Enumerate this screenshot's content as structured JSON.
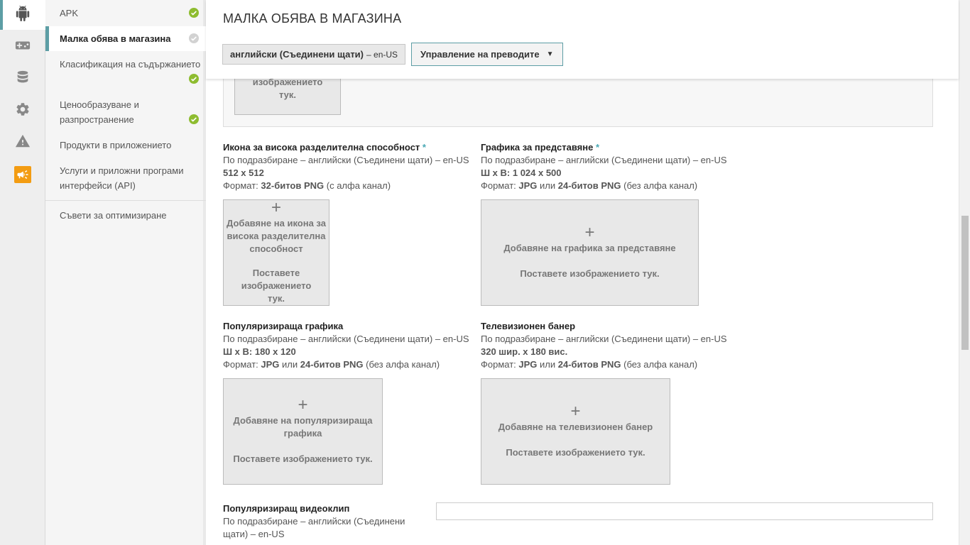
{
  "rail": {
    "items": [
      {
        "icon": "android-icon"
      },
      {
        "icon": "gamepad-icon"
      },
      {
        "icon": "database-icon"
      },
      {
        "icon": "gear-icon"
      },
      {
        "icon": "alert-icon"
      },
      {
        "icon": "megaphone-icon"
      }
    ],
    "accent": "#5d9ea5",
    "orange": "#f39c12"
  },
  "nav": {
    "items": [
      {
        "label": "APK",
        "status": "complete"
      },
      {
        "label": "Малка обява в магазина",
        "status": "incomplete"
      },
      {
        "label": "Класификация на съдържанието",
        "status": "complete"
      },
      {
        "label": "Ценообразуване и разпространение",
        "status": "complete"
      },
      {
        "label": "Продукти в приложението"
      },
      {
        "label": "Услуги и приложни програми интерфейси (API)"
      },
      {
        "label": "Съвети за оптимизиране"
      }
    ],
    "check_color": "#8ebc30"
  },
  "header": {
    "title": "МАЛКА ОБЯВА В МАГАЗИНА",
    "language": "английски (Съединени щати)",
    "language_code": "– en-US",
    "translations_button": "Управление на преводите"
  },
  "prev_drop": {
    "text": "Поставете изображението тук."
  },
  "fields": {
    "hi_res_icon": {
      "label": "Икона за висока разделителна способност",
      "required": "*",
      "default": "По подразбиране – английски (Съединени щати) – en-US",
      "size": "512 x 512",
      "format_prefix": "Формат: ",
      "format_bold": "32-битов PNG",
      "format_suffix": " (с алфа канал)",
      "drop_plus": "+",
      "drop_add": "Добавяне на икона за висока разделителна способност",
      "drop_paste": "Поставете изображението тук."
    },
    "feature_graphic": {
      "label": "Графика за представяне",
      "required": "*",
      "default": "По подразбиране – английски (Съединени щати) – en-US",
      "size": "Ш x В: 1 024 x 500",
      "format_prefix": "Формат: ",
      "format_a": "JPG",
      "format_or": " или ",
      "format_b": "24-битов PNG",
      "format_suffix": " (без алфа канал)",
      "drop_plus": "+",
      "drop_add": "Добавяне на графика за представяне",
      "drop_paste": "Поставете изображението тук."
    },
    "promo_graphic": {
      "label": "Популяризираща графика",
      "default": "По подразбиране – английски (Съединени щати) – en-US",
      "size": "Ш x В: 180 x 120",
      "format_prefix": "Формат: ",
      "format_a": "JPG",
      "format_or": " или ",
      "format_b": "24-битов PNG",
      "format_suffix": " (без алфа канал)",
      "drop_plus": "+",
      "drop_add": "Добавяне на популяризираща графика",
      "drop_paste": "Поставете изображението тук."
    },
    "tv_banner": {
      "label": "Телевизионен банер",
      "default": "По подразбиране – английски (Съединени щати) – en-US",
      "size": "320 шир. x 180 вис.",
      "format_prefix": "Формат: ",
      "format_a": "JPG",
      "format_or": " или ",
      "format_b": "24-битов PNG",
      "format_suffix": " (без алфа канал)",
      "drop_plus": "+",
      "drop_add": "Добавяне на телевизионен банер",
      "drop_paste": "Поставете изображението тук."
    },
    "promo_video": {
      "label": "Популяризиращ видеоклип",
      "default": "По подразбиране – английски (Съединени щати) – en-US",
      "value": ""
    }
  }
}
